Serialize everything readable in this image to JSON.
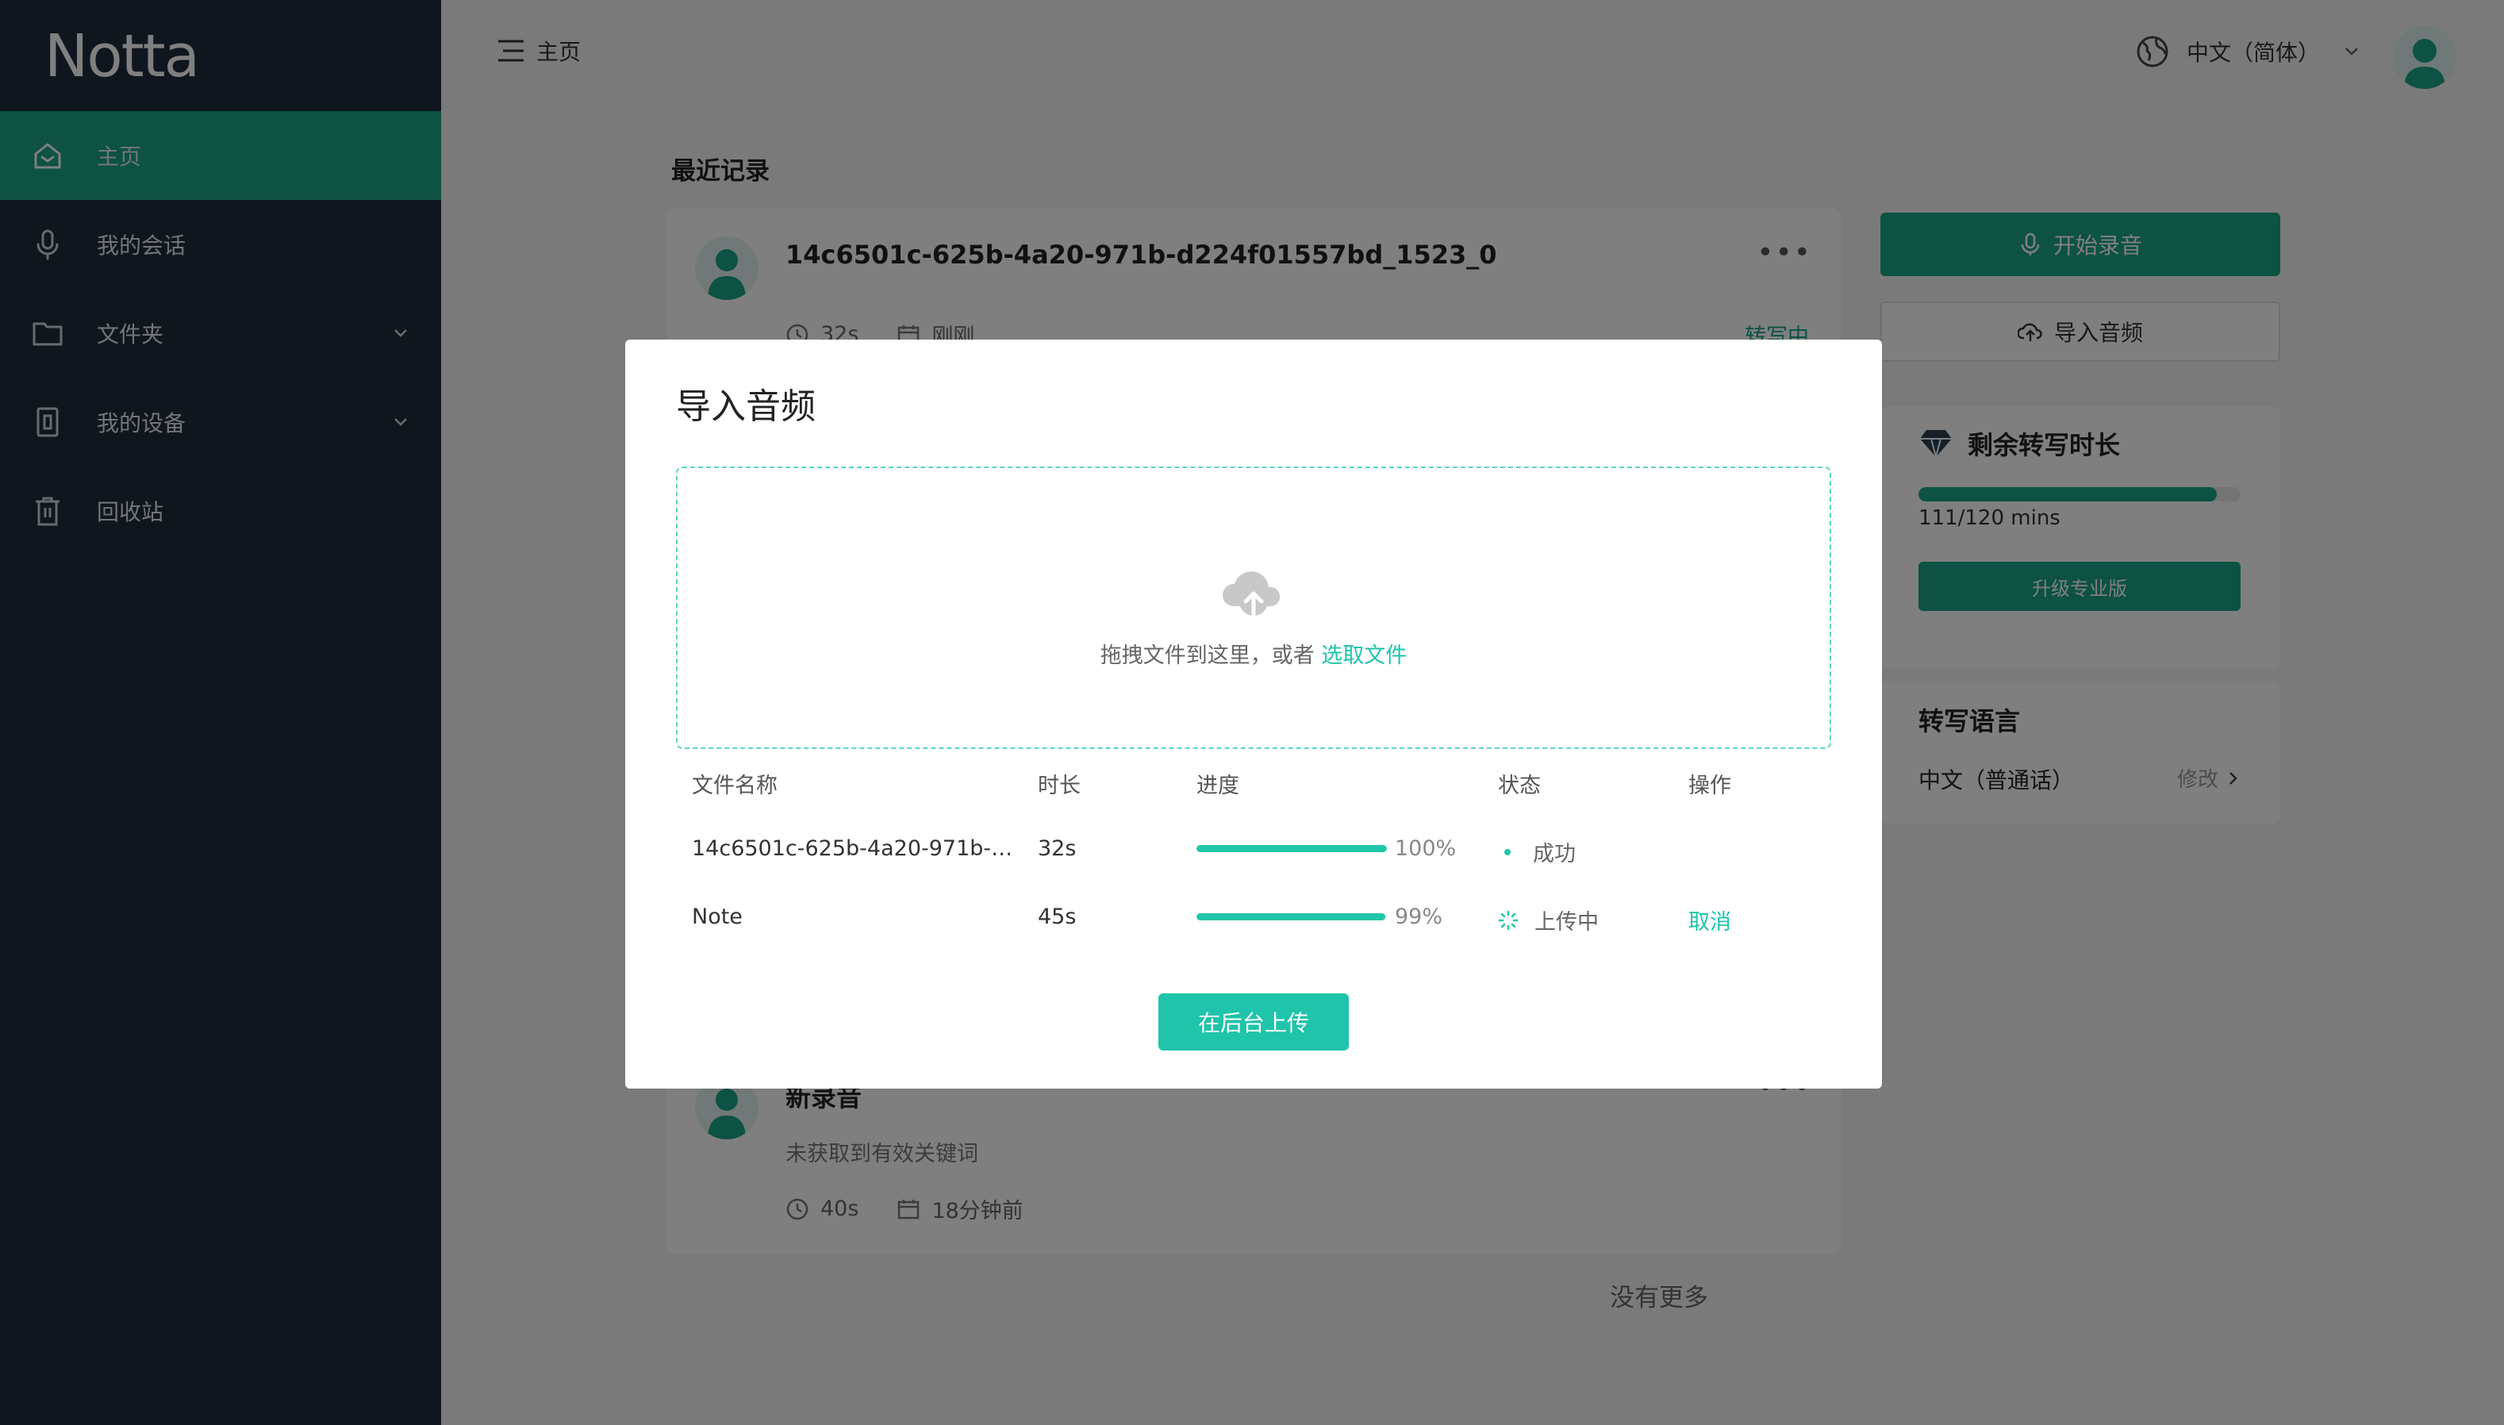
{
  "app": {
    "logo_text": "Notta"
  },
  "sidebar": {
    "items": [
      {
        "label": "主页",
        "icon": "home-icon",
        "active": true
      },
      {
        "label": "我的会话",
        "icon": "microphone-icon"
      },
      {
        "label": "文件夹",
        "icon": "folder-icon",
        "expandable": true
      },
      {
        "label": "我的设备",
        "icon": "device-icon",
        "expandable": true
      },
      {
        "label": "回收站",
        "icon": "trash-icon"
      }
    ]
  },
  "header": {
    "breadcrumb": "主页",
    "language": "中文（简体）"
  },
  "main": {
    "section_title": "最近记录",
    "records": [
      {
        "title": "14c6501c-625b-4a20-971b-d224f01557bd_1523_0",
        "duration": "32s",
        "date": "刚刚",
        "status": "转写中"
      },
      {
        "title": "新录音",
        "subtitle": "未获取到有效关键词",
        "duration": "40s",
        "date": "18分钟前"
      }
    ],
    "no_more": "没有更多"
  },
  "right_panel": {
    "record_button": "开始录音",
    "import_button": "导入音频",
    "quota": {
      "title": "剩余转写时长",
      "used": 111,
      "total": 120,
      "text": "111/120 mins",
      "upgrade_button": "升级专业版"
    },
    "transcribe_language": {
      "title": "转写语言",
      "value": "中文（普通话）",
      "edit_label": "修改"
    }
  },
  "modal": {
    "title": "导入音频",
    "dropzone": {
      "text": "拖拽文件到这里，或者",
      "link": "选取文件"
    },
    "table": {
      "headers": {
        "name": "文件名称",
        "duration": "时长",
        "progress": "进度",
        "status": "状态",
        "action": "操作"
      },
      "rows": [
        {
          "name": "14c6501c-625b-4a20-971b-d224f01557bd_1523_0",
          "duration": "32s",
          "progress": 100,
          "progress_text": "100%",
          "status": "成功",
          "action": ""
        },
        {
          "name": "Note",
          "duration": "45s",
          "progress": 99,
          "progress_text": "99%",
          "status": "上传中",
          "action": "取消"
        }
      ]
    },
    "background_button": "在后台上传"
  },
  "colors": {
    "accent": "#1ba586",
    "accent_light": "#1fc4aa",
    "sidebar_bg": "#1f2d3d",
    "overlay": "rgba(0,0,0,0.5)"
  }
}
